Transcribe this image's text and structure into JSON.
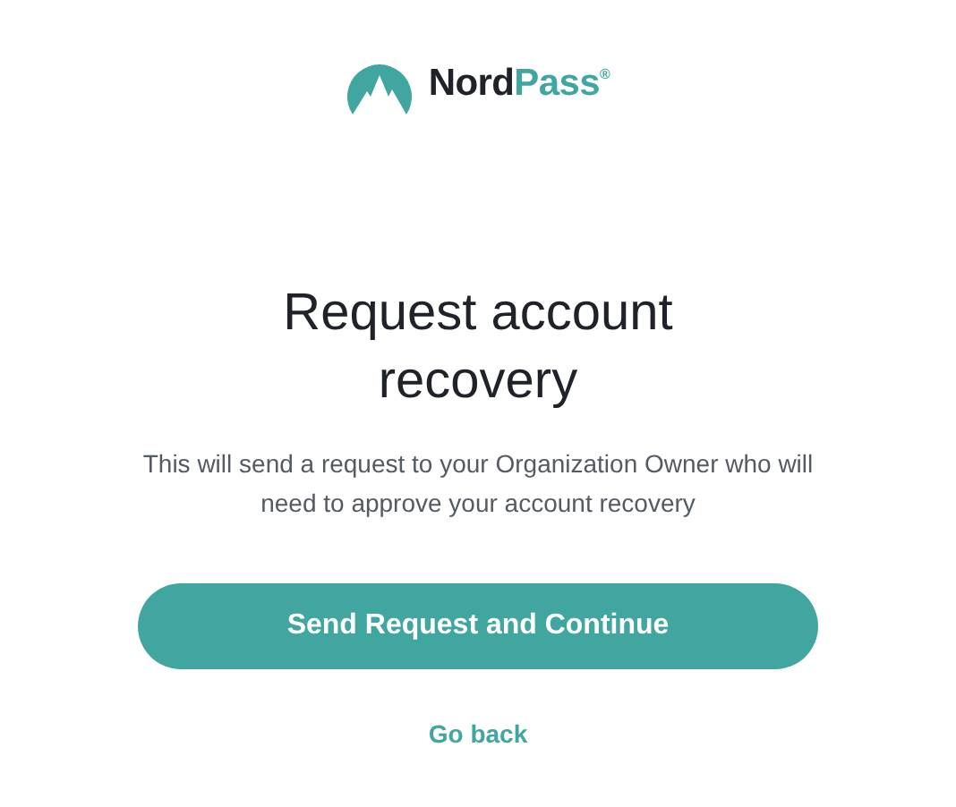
{
  "logo": {
    "name_dark": "Nord",
    "name_accent": "Pass",
    "mark": "®"
  },
  "title": "Request account recovery",
  "description": "This will send a request to your Organization Owner who will need to approve your account recovery",
  "primary_button": "Send Request and Continue",
  "back_link": "Go back"
}
